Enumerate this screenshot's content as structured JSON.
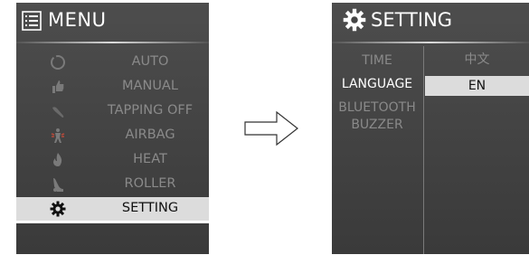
{
  "menu": {
    "title": "MENU",
    "items": [
      {
        "label": "AUTO",
        "icon": "auto-cycle-icon"
      },
      {
        "label": "MANUAL",
        "icon": "hand-icon"
      },
      {
        "label": "TAPPING OFF",
        "icon": "tapping-icon"
      },
      {
        "label": "AIRBAG",
        "icon": "airbag-icon"
      },
      {
        "label": "HEAT",
        "icon": "flame-icon"
      },
      {
        "label": "ROLLER",
        "icon": "roller-icon"
      },
      {
        "label": "SETTING",
        "icon": "gear-icon",
        "selected": true
      }
    ]
  },
  "setting": {
    "title": "SETTING",
    "items": [
      {
        "label": "TIME"
      },
      {
        "label": "LANGUAGE",
        "active": true
      },
      {
        "label": "BLUETOOTH"
      },
      {
        "label": "BUZZER"
      }
    ],
    "language_options": [
      {
        "label": "中文"
      },
      {
        "label": "EN",
        "selected": true
      }
    ]
  },
  "colors": {
    "panel_bg": "#444444",
    "selected_bg": "#dcdcdc",
    "dim_text": "#8a8a8a",
    "active_text": "#ffffff"
  }
}
